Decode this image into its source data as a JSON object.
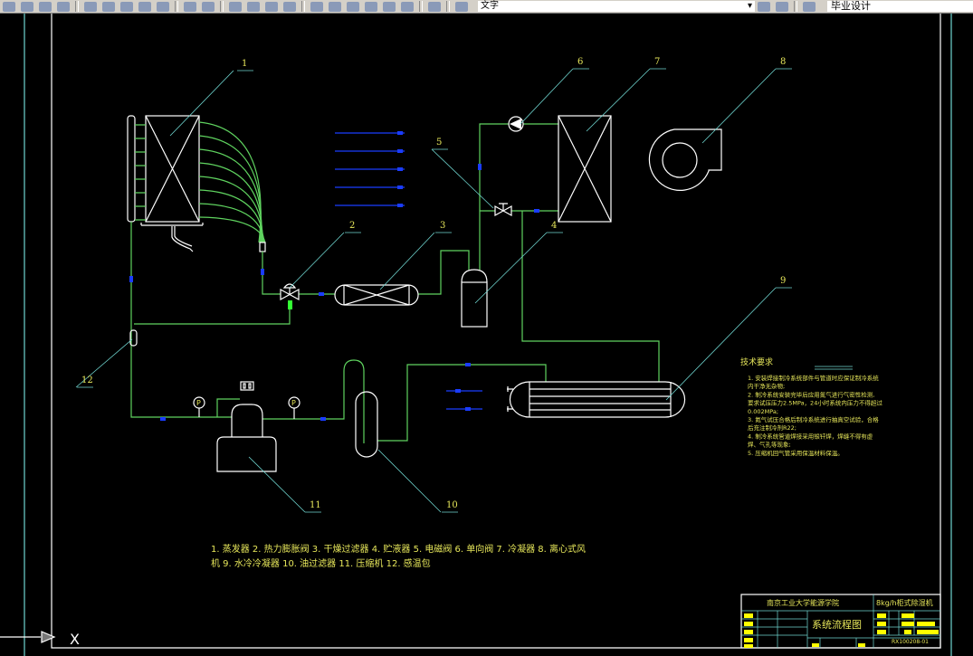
{
  "toolbar": {
    "layer": "文字",
    "style": "毕业设计"
  },
  "labels": [
    "1",
    "2",
    "3",
    "4",
    "5",
    "6",
    "7",
    "8",
    "9",
    "10",
    "11",
    "12"
  ],
  "legend": {
    "line1": "1. 蒸发器 2. 热力膨胀阀 3. 干燥过滤器 4. 贮液器 5. 电磁阀 6. 单向阀 7. 冷凝器 8. 离心式风",
    "line2": "机 9. 水冷冷凝器 10. 油过滤器 11. 压缩机 12. 感温包"
  },
  "tech": {
    "title": "技术要求",
    "items": [
      "1.    安装焊接制冷系统部件与管道时应保证制冷系统",
      "  内干净无杂物;",
      "2.    制冷系统安装完毕后应用氮气进行气密性检测,",
      "  要求试压压力2.5MPa，24小时系统内压力不得超过",
      "  0.002MPa;",
      "3.    氮气试压合格后制冷系统进行抽真空试验，合格",
      "  后充注制冷剂R22;",
      "4.    制冷系统管道焊接采用银钎焊，焊缝不得有虚",
      "  焊、气孔等现象;",
      "5.    压缩机回气管采用保温材料保温。"
    ]
  },
  "title_block": {
    "school": "南京工业大学能源学院",
    "product": "8kg/h柜式除湿机",
    "drawing": "系统流程图",
    "number": "RX100208-01"
  },
  "ucs": {
    "axis": "X"
  },
  "colors": {
    "pipe": "#5fd35f",
    "arrow": "#1a3cff",
    "leader": "#6fd6d0",
    "text": "#e6e65a"
  }
}
